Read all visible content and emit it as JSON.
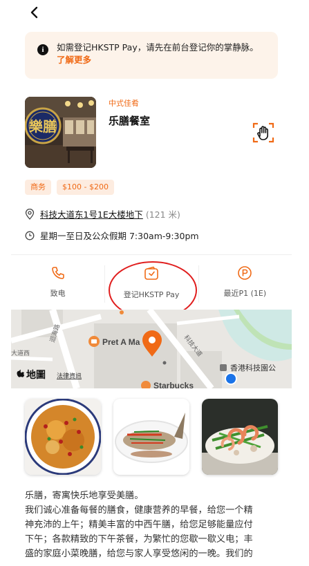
{
  "notice": {
    "text": "如需登记HKSTP Pay，请先在前台登记你的掌静脉。",
    "link": "了解更多"
  },
  "restaurant": {
    "image_sign": "樂膳",
    "cuisine": "中式佳肴",
    "name": "乐膳餐室",
    "tags": [
      "商务",
      "$100 - $200"
    ],
    "address": "科技大道东1号1E大楼地下",
    "distance": "(121 米)",
    "hours": "星期一至日及公众假期 7:30am-9:30pm"
  },
  "actions": {
    "call": "致电",
    "register": "登记HKSTP Pay",
    "parking": "最近P1 (1E)"
  },
  "map": {
    "logo": "地圖",
    "legal": "法律資訊",
    "poi_pret": "Pret A Ma",
    "poi_starbucks": "Starbucks",
    "poi_hkstp": "香港科技園公",
    "road_1": "科技大道",
    "road_2": "迴海路",
    "road_3": "大道西"
  },
  "description": {
    "lines": [
      "乐膳，寄寓快乐地享受美膳。",
      "我们诚心准备每餐的膳食，健康营养的早餐，给您一个精",
      "神充沛的上午；精美丰富的中西午膳，给您足够能量应付",
      "下午；各款精致的下午茶餐，为繁忙的您歇一歇义电；丰",
      "盛的家庭小菜晚膳，给您与家人享受悠闲的一晚。我们的"
    ]
  },
  "colors": {
    "accent": "#f06a16",
    "notice_bg": "#fdf3ea",
    "highlight_ring": "#e01e1e",
    "map_bg": "#e9e7e3",
    "water": "#cfe9e5",
    "location_dot": "#1a73e8"
  }
}
